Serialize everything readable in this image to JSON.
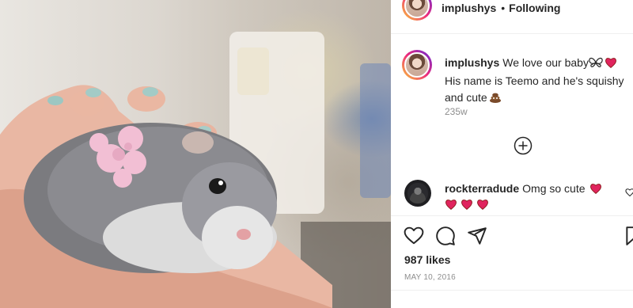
{
  "post": {
    "author": "implushys",
    "separator": "•",
    "follow_status": "Following",
    "caption": {
      "part1": "We love our baby",
      "part2": " His name is Teemo and he's squishy and cute",
      "emojis": [
        "butterfly-emoji",
        "red-heart-emoji",
        "poop-emoji"
      ]
    },
    "caption_age": "235w",
    "load_more_icon": "plus-circle-icon",
    "comments": [
      {
        "user": "rockterradude",
        "text": "Omg so cute",
        "emojis": [
          "red-heart-emoji",
          "red-heart-emoji",
          "red-heart-emoji",
          "red-heart-emoji"
        ]
      }
    ],
    "actions": [
      "heart-icon",
      "comment-icon",
      "share-icon",
      "bookmark-icon"
    ],
    "likes": "987 likes",
    "date": "MAY 10, 2016"
  },
  "colors": {
    "text": "#262626",
    "muted": "#8e8e8e",
    "divider": "#efefef",
    "heart": "#e0245e"
  }
}
